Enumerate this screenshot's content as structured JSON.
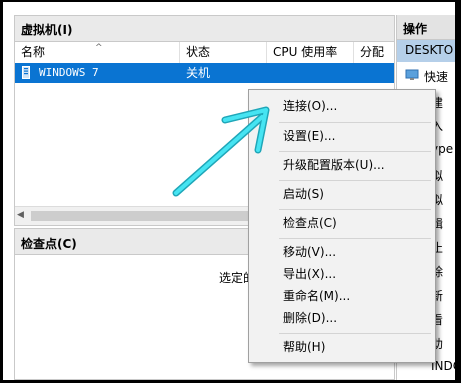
{
  "vm_panel": {
    "title": "虚拟机(I)",
    "columns": [
      "名称",
      "状态",
      "CPU 使用率",
      "分配的"
    ],
    "rows": [
      {
        "name": "WINDOWS 7",
        "state": "关机"
      }
    ]
  },
  "checkpoint_panel": {
    "title": "检查点(C)",
    "empty_text": "选定的"
  },
  "actions_pane": {
    "title": "操作",
    "host": "DESKTO",
    "items": [
      "快速",
      "建",
      "入",
      "ype",
      "拟",
      "拟",
      "辑",
      "止",
      "除",
      "新",
      "看",
      "助",
      "INDO"
    ]
  },
  "context_menu": {
    "items": [
      "连接(O)...",
      "设置(E)...",
      "升级配置版本(U)...",
      "启动(S)",
      "检查点(C)",
      "移动(V)...",
      "导出(X)...",
      "重命名(M)...",
      "删除(D)...",
      "帮助(H)"
    ]
  },
  "colors": {
    "selection": "#0a74d2",
    "annotation_arrow": "#2ed3e6",
    "menu_bg": "#f2f2f2",
    "host_highlight": "#b5cfe9"
  }
}
